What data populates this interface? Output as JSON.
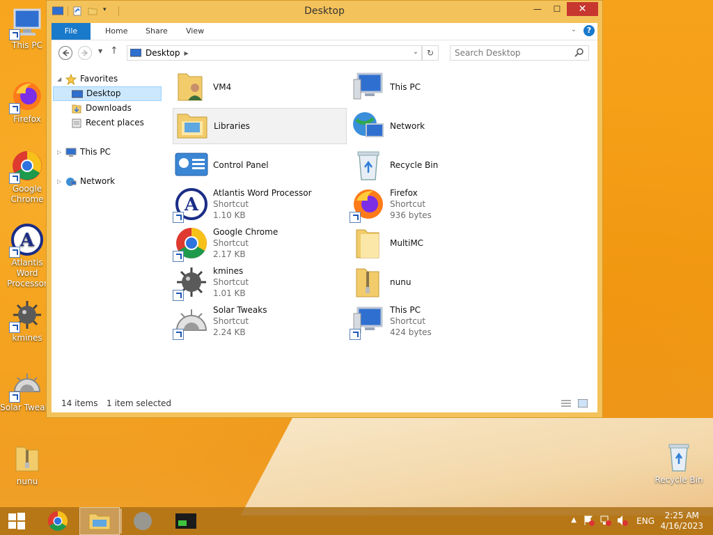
{
  "desktop": {
    "icons": [
      {
        "label": "This PC",
        "icon": "this-pc-icon"
      },
      {
        "label": "Firefox",
        "icon": "firefox-icon"
      },
      {
        "label": "Google Chrome",
        "icon": "chrome-icon"
      },
      {
        "label": "Atlantis Word Processor",
        "icon": "atlantis-icon"
      },
      {
        "label": "kmines",
        "icon": "kmines-icon"
      },
      {
        "label": "Solar Tweaks",
        "icon": "solar-tweaks-icon"
      },
      {
        "label": "nunu",
        "icon": "zip-folder-icon"
      },
      {
        "label": "Recycle Bin",
        "icon": "recycle-bin-icon"
      }
    ]
  },
  "window": {
    "title": "Desktop",
    "controls": {
      "minimize": "—",
      "maximize": "☐",
      "close": "✕"
    },
    "ribbon_tabs": [
      "File",
      "Home",
      "Share",
      "View"
    ],
    "address": "Desktop",
    "search_placeholder": "Search Desktop",
    "sidebar": {
      "favorites": "Favorites",
      "items": [
        "Desktop",
        "Downloads",
        "Recent places"
      ],
      "this_pc": "This PC",
      "network": "Network"
    },
    "files": [
      {
        "name": "VM4",
        "sub": "",
        "size": "",
        "icon": "user-folder-icon"
      },
      {
        "name": "This PC",
        "sub": "",
        "size": "",
        "icon": "this-pc-icon"
      },
      {
        "name": "Libraries",
        "sub": "",
        "size": "",
        "icon": "libraries-icon"
      },
      {
        "name": "Network",
        "sub": "",
        "size": "",
        "icon": "network-icon"
      },
      {
        "name": "Control Panel",
        "sub": "",
        "size": "",
        "icon": "control-panel-icon"
      },
      {
        "name": "Recycle Bin",
        "sub": "",
        "size": "",
        "icon": "recycle-bin-icon"
      },
      {
        "name": "Atlantis Word Processor",
        "sub": "Shortcut",
        "size": "1.10 KB",
        "icon": "atlantis-icon"
      },
      {
        "name": "Firefox",
        "sub": "Shortcut",
        "size": "936 bytes",
        "icon": "firefox-icon"
      },
      {
        "name": "Google Chrome",
        "sub": "Shortcut",
        "size": "2.17 KB",
        "icon": "chrome-icon"
      },
      {
        "name": "MultiMC",
        "sub": "",
        "size": "",
        "icon": "folder-icon"
      },
      {
        "name": "kmines",
        "sub": "Shortcut",
        "size": "1.01 KB",
        "icon": "kmines-icon"
      },
      {
        "name": "nunu",
        "sub": "",
        "size": "",
        "icon": "zip-folder-icon"
      },
      {
        "name": "Solar Tweaks",
        "sub": "Shortcut",
        "size": "2.24 KB",
        "icon": "solar-tweaks-icon"
      },
      {
        "name": "This PC",
        "sub": "Shortcut",
        "size": "424 bytes",
        "icon": "this-pc-icon"
      }
    ],
    "status": {
      "count": "14 items",
      "selected": "1 item selected"
    }
  },
  "taskbar": {
    "language": "ENG",
    "time": "2:25 AM",
    "date": "4/16/2023"
  }
}
